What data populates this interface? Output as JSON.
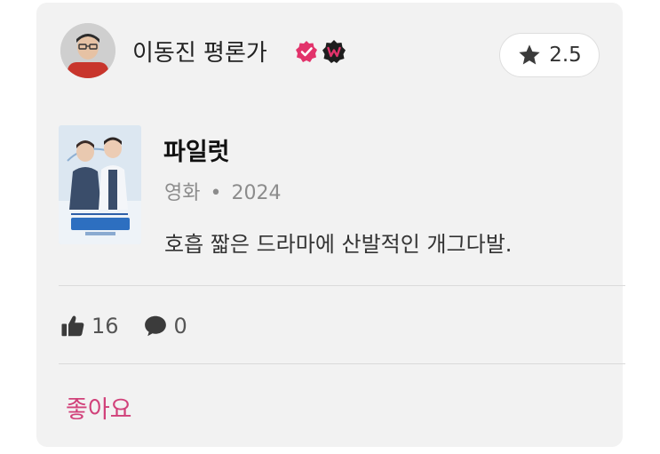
{
  "review": {
    "author_name": "이동진 평론가",
    "icons": {
      "avatar": "avatar",
      "verified": "verified-check-icon",
      "badge": "w-badge-icon",
      "rating": "star-icon",
      "likes": "thumbs-up-icon",
      "comments": "speech-bubble-icon"
    },
    "rating": "2.5",
    "content": {
      "title": "파일럿",
      "category": "영화",
      "separator": "•",
      "year": "2024",
      "comment": "호흡 짧은 드라마에 산발적인 개그다발."
    },
    "stats": {
      "likes": "16",
      "comments": "0"
    },
    "like_label": "좋아요"
  },
  "colors": {
    "accent": "#d1417a",
    "card_background": "#f2f2f2",
    "verified_badge": "#e2336b"
  }
}
